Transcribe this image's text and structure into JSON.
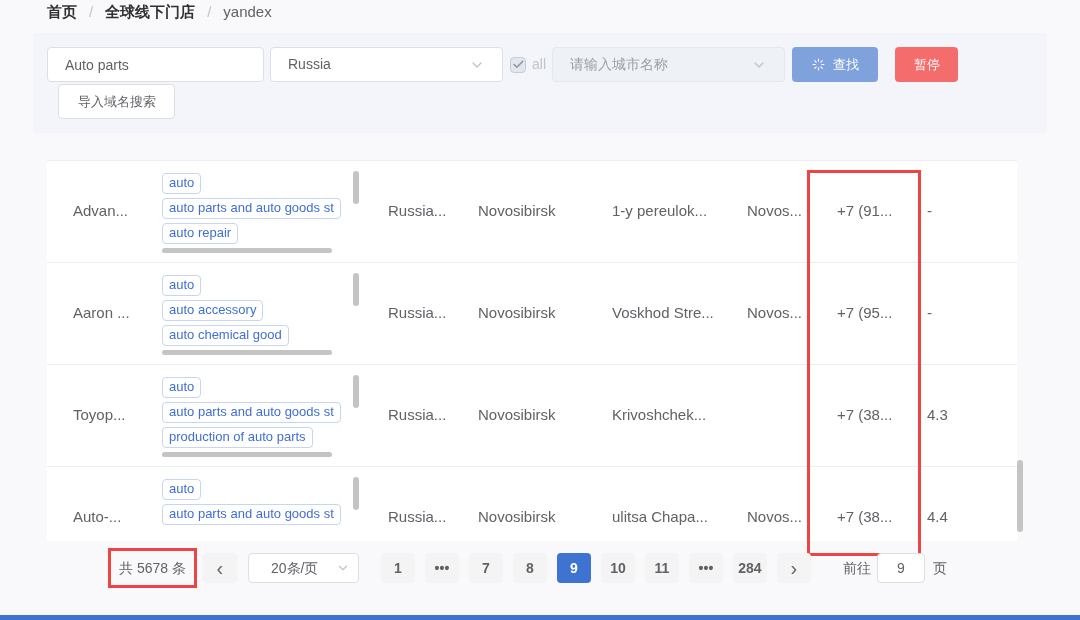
{
  "breadcrumb": [
    {
      "label": "首页",
      "current": false
    },
    {
      "label": "全球线下门店",
      "current": false
    },
    {
      "label": "yandex",
      "current": true
    }
  ],
  "separator": "/",
  "filters": {
    "keyword": "Auto parts",
    "country": "Russia",
    "all_checkbox": {
      "label": "all",
      "checked": true,
      "disabled": true
    },
    "city": {
      "placeholder": "请输入城市名称",
      "disabled": true
    },
    "search_button": {
      "label": "查找",
      "loading": true
    },
    "pause_button": "暂停",
    "import_button": "导入域名搜索"
  },
  "table": {
    "phone_column_highlighted": true,
    "rows": [
      {
        "name": "Advan...",
        "tags": [
          "auto",
          "auto parts and auto goods st",
          "auto repair"
        ],
        "country": "Russia...",
        "city": "Novosibirsk",
        "address": "1-y pereulok...",
        "locality": "Novos...",
        "phone": "+7 (91...",
        "rating": "-"
      },
      {
        "name": "Aaron ...",
        "tags": [
          "auto",
          "auto accessory",
          "auto chemical good"
        ],
        "country": "Russia...",
        "city": "Novosibirsk",
        "address": "Voskhod Stre...",
        "locality": "Novos...",
        "phone": "+7 (95...",
        "rating": "-"
      },
      {
        "name": "Toyop...",
        "tags": [
          "auto",
          "auto parts and auto goods st",
          "production of auto parts"
        ],
        "country": "Russia...",
        "city": "Novosibirsk",
        "address": "Krivoshchek...",
        "phone": "+7 (38...",
        "rating": "4.3"
      },
      {
        "name": "Auto-...",
        "tags": [
          "auto",
          "auto parts and auto goods st"
        ],
        "country": "Russia...",
        "city": "Novosibirsk",
        "address": "ulitsa Chapa...",
        "locality": "Novos...",
        "phone": "+7 (38...",
        "rating": "4.4"
      }
    ]
  },
  "pagination": {
    "total": "共 5678 条",
    "total_highlighted": true,
    "prev": "‹",
    "page_size": "20条/页",
    "pages": [
      {
        "label": "1",
        "selected": false
      },
      {
        "label": "•••",
        "selected": false
      },
      {
        "label": "7",
        "selected": false
      },
      {
        "label": "8",
        "selected": false
      },
      {
        "label": "9",
        "selected": true
      },
      {
        "label": "10",
        "selected": false
      },
      {
        "label": "11",
        "selected": false
      },
      {
        "label": "•••",
        "selected": false
      },
      {
        "label": "284",
        "selected": false
      }
    ],
    "next": "›",
    "goto_label": "前往",
    "goto_value": "9",
    "goto_suffix": "页"
  }
}
